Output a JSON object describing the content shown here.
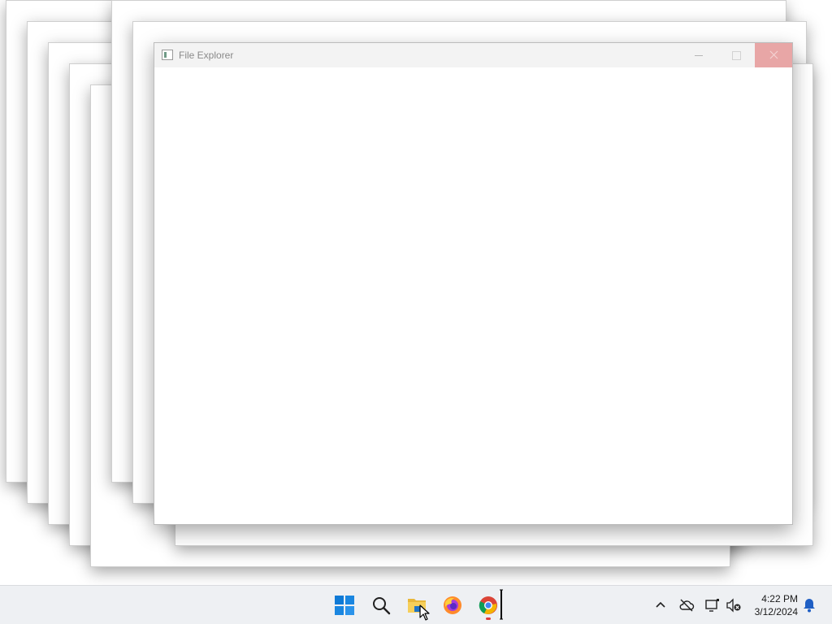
{
  "window": {
    "title": "File Explorer",
    "icon": "app-window-icon",
    "controls": [
      "minimize-icon",
      "maximize-icon",
      "close-icon"
    ]
  },
  "taskbar": {
    "apps": [
      {
        "name": "start",
        "icon": "windows-logo-icon"
      },
      {
        "name": "search",
        "icon": "search-icon"
      },
      {
        "name": "file-explorer",
        "icon": "folder-icon",
        "running": true
      },
      {
        "name": "firefox",
        "icon": "firefox-icon"
      },
      {
        "name": "chrome",
        "icon": "chrome-icon",
        "running": true
      }
    ],
    "tray": {
      "icons": [
        "chevron-up-icon",
        "cloud-offline-icon",
        "network-icon",
        "volume-muted-icon",
        "bell-icon"
      ],
      "time": "4:22 PM",
      "date": "3/12/2024"
    }
  },
  "colors": {
    "accent": "#0078d4",
    "close_hover": "#e8a6a6",
    "running_indicator": "#e13b3b",
    "taskbar": "#eef0f3"
  }
}
